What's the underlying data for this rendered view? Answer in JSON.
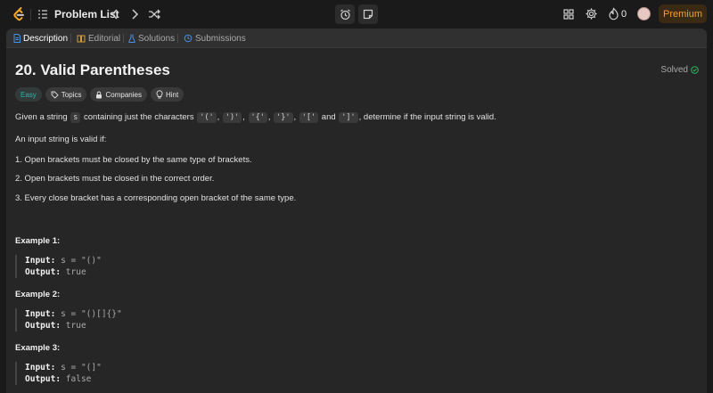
{
  "topbar": {
    "problem_list_label": "Problem List",
    "streak_count": "0",
    "premium_label": "Premium",
    "icons": [
      "leetcode-logo",
      "list-icon",
      "chevron-left-icon",
      "chevron-right-icon",
      "shuffle-icon",
      "alarm-icon",
      "note-icon",
      "grid-icon",
      "gear-icon",
      "flame-icon",
      "avatar"
    ]
  },
  "tabs": [
    {
      "label": "Description",
      "active": true,
      "icon": "document-icon"
    },
    {
      "label": "Editorial",
      "active": false,
      "icon": "book-icon"
    },
    {
      "label": "Solutions",
      "active": false,
      "icon": "flask-icon"
    },
    {
      "label": "Submissions",
      "active": false,
      "icon": "history-icon"
    }
  ],
  "problem": {
    "title": "20. Valid Parentheses",
    "status": "Solved",
    "chips": {
      "difficulty": "Easy",
      "topics": "Topics",
      "companies": "Companies",
      "hint": "Hint"
    },
    "intro": {
      "pre": "Given a string ",
      "s": "s",
      "mid": " containing just the characters ",
      "c1": "'('",
      "c2": "')'",
      "c3": "'{'",
      "c4": "'}'",
      "c5": "'['",
      "and": " and ",
      "c6": "']'",
      "post": ", determine if the input string is valid."
    },
    "valid_if": "An input string is valid if:",
    "rules": [
      "1. Open brackets must be closed by the same type of brackets.",
      "2. Open brackets must be closed in the correct order.",
      "3. Every close bracket has a corresponding open bracket of the same type."
    ],
    "examples": [
      {
        "heading": "Example 1:",
        "input": "s = \"()\"",
        "output": "true"
      },
      {
        "heading": "Example 2:",
        "input": "s = \"()[]{}\"",
        "output": "true"
      },
      {
        "heading": "Example 3:",
        "input": "s = \"(]\"",
        "output": "false"
      }
    ],
    "input_label": "Input:",
    "output_label": "Output:"
  },
  "colors": {
    "accent": "#f59e2c",
    "easy": "#2db3a6",
    "solved_check": "#2cbb5d",
    "panel": "#262626",
    "page": "#1a1a1a"
  }
}
